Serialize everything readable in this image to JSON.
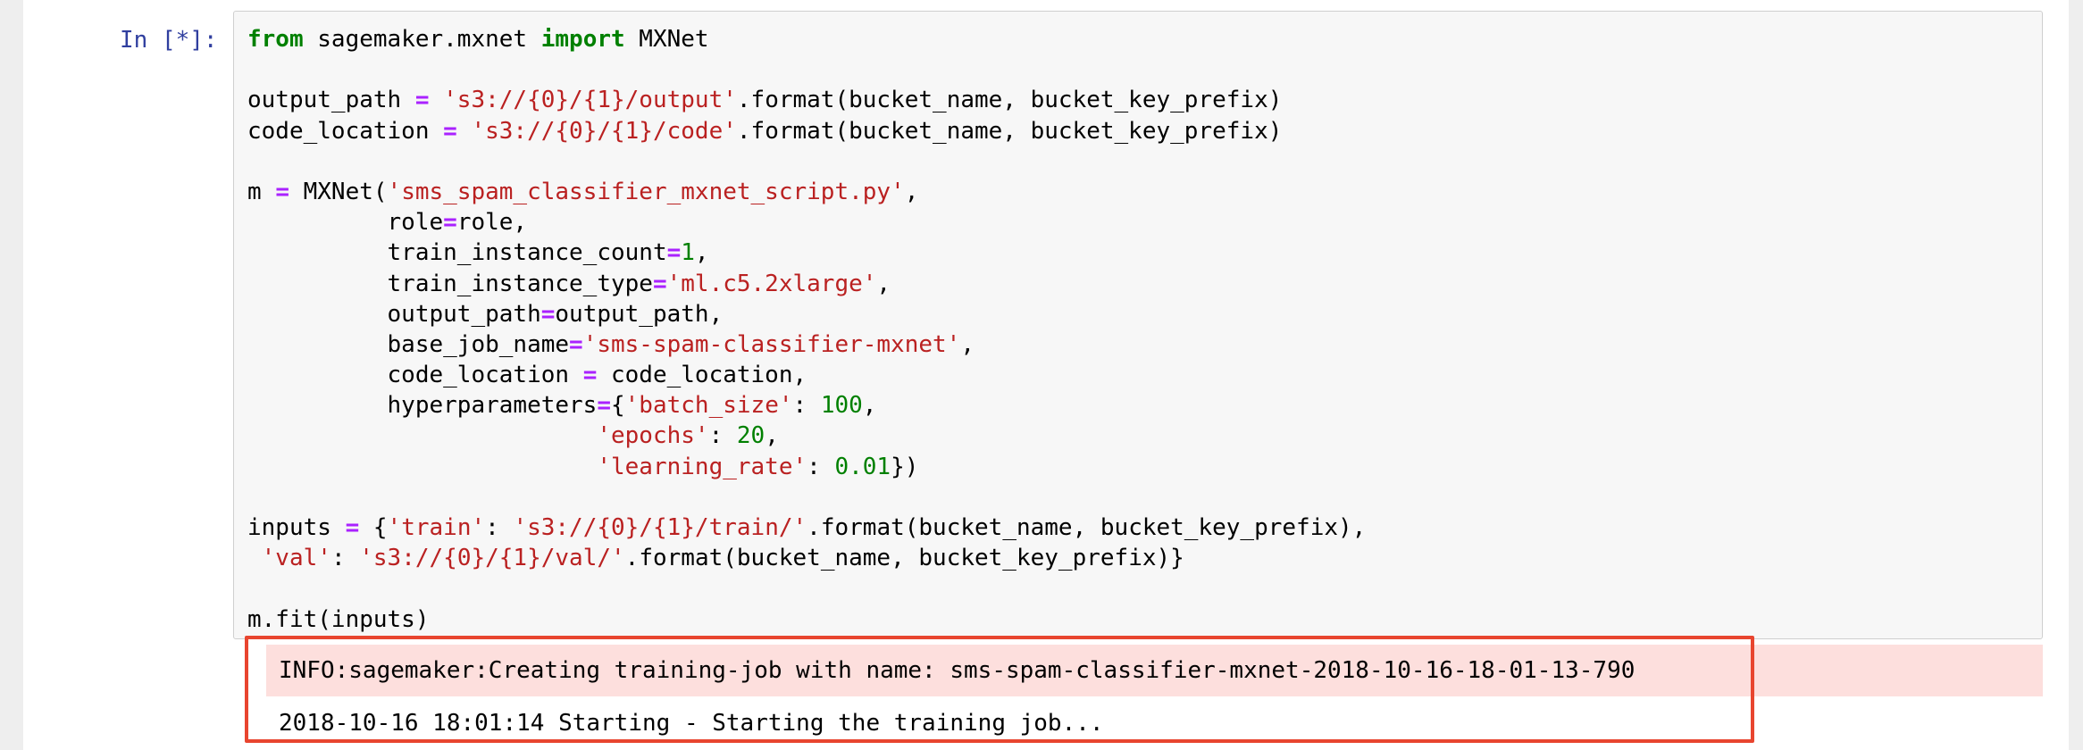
{
  "cell": {
    "prompt": "In [*]:",
    "code_lines": [
      [
        {
          "t": "from",
          "c": "kw"
        },
        {
          "t": " sagemaker.mxnet "
        },
        {
          "t": "import",
          "c": "kw"
        },
        {
          "t": " MXNet"
        }
      ],
      [],
      [
        {
          "t": "output_path "
        },
        {
          "t": "=",
          "c": "op"
        },
        {
          "t": " "
        },
        {
          "t": "'s3://{0}/{1}/output'",
          "c": "str"
        },
        {
          "t": ".format(bucket_name, bucket_key_prefix)"
        }
      ],
      [
        {
          "t": "code_location "
        },
        {
          "t": "=",
          "c": "op"
        },
        {
          "t": " "
        },
        {
          "t": "'s3://{0}/{1}/code'",
          "c": "str"
        },
        {
          "t": ".format(bucket_name, bucket_key_prefix)"
        }
      ],
      [],
      [
        {
          "t": "m "
        },
        {
          "t": "=",
          "c": "op"
        },
        {
          "t": " MXNet("
        },
        {
          "t": "'sms_spam_classifier_mxnet_script.py'",
          "c": "str"
        },
        {
          "t": ","
        }
      ],
      [
        {
          "t": "          role"
        },
        {
          "t": "=",
          "c": "op"
        },
        {
          "t": "role,"
        }
      ],
      [
        {
          "t": "          train_instance_count"
        },
        {
          "t": "=",
          "c": "op"
        },
        {
          "t": "1",
          "c": "num"
        },
        {
          "t": ","
        }
      ],
      [
        {
          "t": "          train_instance_type"
        },
        {
          "t": "=",
          "c": "op"
        },
        {
          "t": "'ml.c5.2xlarge'",
          "c": "str"
        },
        {
          "t": ","
        }
      ],
      [
        {
          "t": "          output_path"
        },
        {
          "t": "=",
          "c": "op"
        },
        {
          "t": "output_path,"
        }
      ],
      [
        {
          "t": "          base_job_name"
        },
        {
          "t": "=",
          "c": "op"
        },
        {
          "t": "'sms-spam-classifier-mxnet'",
          "c": "str"
        },
        {
          "t": ","
        }
      ],
      [
        {
          "t": "          code_location "
        },
        {
          "t": "=",
          "c": "op"
        },
        {
          "t": " code_location,"
        }
      ],
      [
        {
          "t": "          hyperparameters"
        },
        {
          "t": "=",
          "c": "op"
        },
        {
          "t": "{"
        },
        {
          "t": "'batch_size'",
          "c": "str"
        },
        {
          "t": ": "
        },
        {
          "t": "100",
          "c": "num"
        },
        {
          "t": ","
        }
      ],
      [
        {
          "t": "                         "
        },
        {
          "t": "'epochs'",
          "c": "str"
        },
        {
          "t": ": "
        },
        {
          "t": "20",
          "c": "num"
        },
        {
          "t": ","
        }
      ],
      [
        {
          "t": "                         "
        },
        {
          "t": "'learning_rate'",
          "c": "str"
        },
        {
          "t": ": "
        },
        {
          "t": "0.01",
          "c": "num"
        },
        {
          "t": "})"
        }
      ],
      [],
      [
        {
          "t": "inputs "
        },
        {
          "t": "=",
          "c": "op"
        },
        {
          "t": " {"
        },
        {
          "t": "'train'",
          "c": "str"
        },
        {
          "t": ": "
        },
        {
          "t": "'s3://{0}/{1}/train/'",
          "c": "str"
        },
        {
          "t": ".format(bucket_name, bucket_key_prefix),"
        }
      ],
      [
        {
          "t": " "
        },
        {
          "t": "'val'",
          "c": "str"
        },
        {
          "t": ": "
        },
        {
          "t": "'s3://{0}/{1}/val/'",
          "c": "str"
        },
        {
          "t": ".format(bucket_name, bucket_key_prefix)}"
        }
      ],
      [],
      [
        {
          "t": "m.fit(inputs)"
        }
      ]
    ]
  },
  "output": {
    "stderr": "INFO:sagemaker:Creating training-job with name: sms-spam-classifier-mxnet-2018-10-16-18-01-13-790",
    "stdout": "2018-10-16 18:01:14 Starting - Starting the training job..."
  },
  "colors": {
    "highlight_border": "#e8452f",
    "stderr_background": "#fddfdd",
    "prompt": "#303f9f"
  }
}
